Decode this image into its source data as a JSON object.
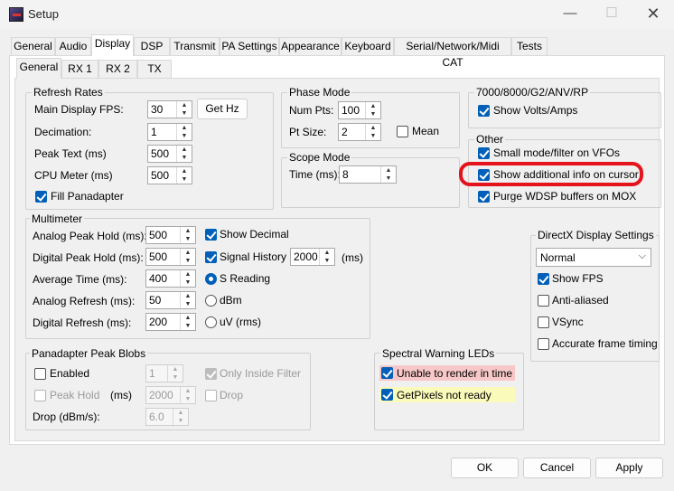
{
  "window": {
    "title": "Setup",
    "min_glyph": "—",
    "max_glyph": "☐",
    "close_glyph": "✕"
  },
  "tabs": [
    "General",
    "Audio",
    "Display",
    "DSP",
    "Transmit",
    "PA Settings",
    "Appearance",
    "Keyboard",
    "Serial/Network/Midi CAT",
    "Tests"
  ],
  "subtabs": [
    "General",
    "RX 1",
    "RX 2",
    "TX"
  ],
  "refresh": {
    "title": "Refresh Rates",
    "fps_label": "Main Display FPS:",
    "fps_value": "30",
    "gethz_label": "Get Hz",
    "decimation_label": "Decimation:",
    "decimation_value": "1",
    "peak_text_label": "Peak Text (ms)",
    "peak_text_value": "500",
    "cpu_label": "CPU Meter (ms)",
    "cpu_value": "500",
    "fill_label": "Fill Panadapter"
  },
  "phase": {
    "title": "Phase Mode",
    "num_pts_label": "Num Pts:",
    "num_pts_value": "100",
    "pt_size_label": "Pt Size:",
    "pt_size_value": "2",
    "mean_label": "Mean"
  },
  "scope": {
    "title": "Scope Mode",
    "time_label": "Time (ms):",
    "time_value": "8"
  },
  "g7000": {
    "title": "7000/8000/G2/ANV/RP",
    "volts_label": "Show Volts/Amps"
  },
  "other": {
    "title": "Other",
    "small_mode_label": "Small mode/filter on VFOs",
    "cursor_info_label": "Show additional info on cursor",
    "purge_label": "Purge WDSP buffers on MOX"
  },
  "multimeter": {
    "title": "Multimeter",
    "analog_hold_label": "Analog Peak Hold (ms):",
    "analog_hold_value": "500",
    "digital_hold_label": "Digital Peak Hold (ms):",
    "digital_hold_value": "500",
    "avg_time_label": "Average Time (ms):",
    "avg_time_value": "400",
    "analog_refresh_label": "Analog Refresh (ms):",
    "analog_refresh_value": "50",
    "digital_refresh_label": "Digital Refresh (ms):",
    "digital_refresh_value": "200",
    "show_decimal_label": "Show Decimal",
    "signal_history_label": "Signal History",
    "signal_history_value": "2000",
    "signal_history_unit": "(ms)",
    "s_reading_label": "S Reading",
    "dbm_label": "dBm",
    "uv_label": "uV (rms)"
  },
  "directx": {
    "title": "DirectX Display Settings",
    "mode_value": "Normal",
    "show_fps_label": "Show FPS",
    "anti_aliased_label": "Anti-aliased",
    "vsync_label": "VSync",
    "accurate_label": "Accurate frame timing"
  },
  "blobs": {
    "title": "Panadapter Peak Blobs",
    "enabled_label": "Enabled",
    "count_value": "1",
    "inside_filter_label": "Only Inside Filter",
    "peak_hold_label": "Peak Hold",
    "ms_label": "(ms)",
    "peak_hold_value": "2000",
    "drop_label": "Drop",
    "drop_rate_label": "Drop (dBm/s):",
    "drop_rate_value": "6.0"
  },
  "leds": {
    "title": "Spectral Warning LEDs",
    "render_label": "Unable to render in time",
    "render_color": "#f8c8c8",
    "pixels_label": "GetPixels not ready",
    "pixels_color": "#fafaba"
  },
  "footer": {
    "ok_label": "OK",
    "cancel_label": "Cancel",
    "apply_label": "Apply"
  },
  "colors": {
    "accent": "#005fb8",
    "highlight_ring": "#e3141b"
  }
}
